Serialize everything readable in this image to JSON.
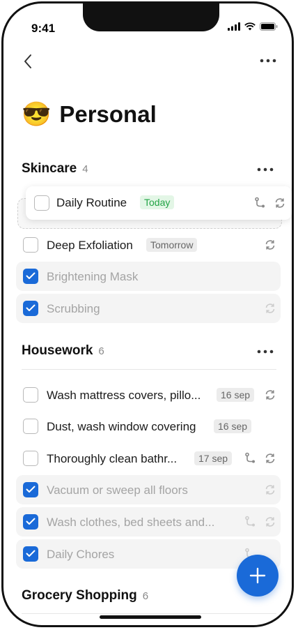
{
  "status_bar": {
    "time": "9:41"
  },
  "page": {
    "emoji": "😎",
    "title": "Personal"
  },
  "sections": [
    {
      "name": "Skincare",
      "count": "4",
      "tasks": [
        {
          "text": "Daily Routine",
          "badge": "Today",
          "done": false,
          "dragging": true
        },
        {
          "text": "Deep Exfoliation",
          "badge": "Tomorrow",
          "done": false
        },
        {
          "text": "Brightening Mask",
          "badge": "",
          "done": true
        },
        {
          "text": "Scrubbing",
          "badge": "",
          "done": true
        }
      ]
    },
    {
      "name": "Housework",
      "count": "6",
      "tasks": [
        {
          "text": "Wash mattress covers, pillo...",
          "badge": "16 sep",
          "done": false
        },
        {
          "text": "Dust, wash window covering",
          "badge": "16 sep",
          "done": false
        },
        {
          "text": "Thoroughly clean bathr...",
          "badge": "17 sep",
          "done": false
        },
        {
          "text": "Vacuum or sweep all floors",
          "badge": "",
          "done": true
        },
        {
          "text": "Wash clothes, bed sheets and...",
          "badge": "",
          "done": true
        },
        {
          "text": "Daily Chores",
          "badge": "",
          "done": true
        }
      ]
    },
    {
      "name": "Grocery Shopping",
      "count": "6",
      "tasks": []
    }
  ],
  "colors": {
    "accent": "#1a6ad8",
    "today_green": "#23a446"
  }
}
